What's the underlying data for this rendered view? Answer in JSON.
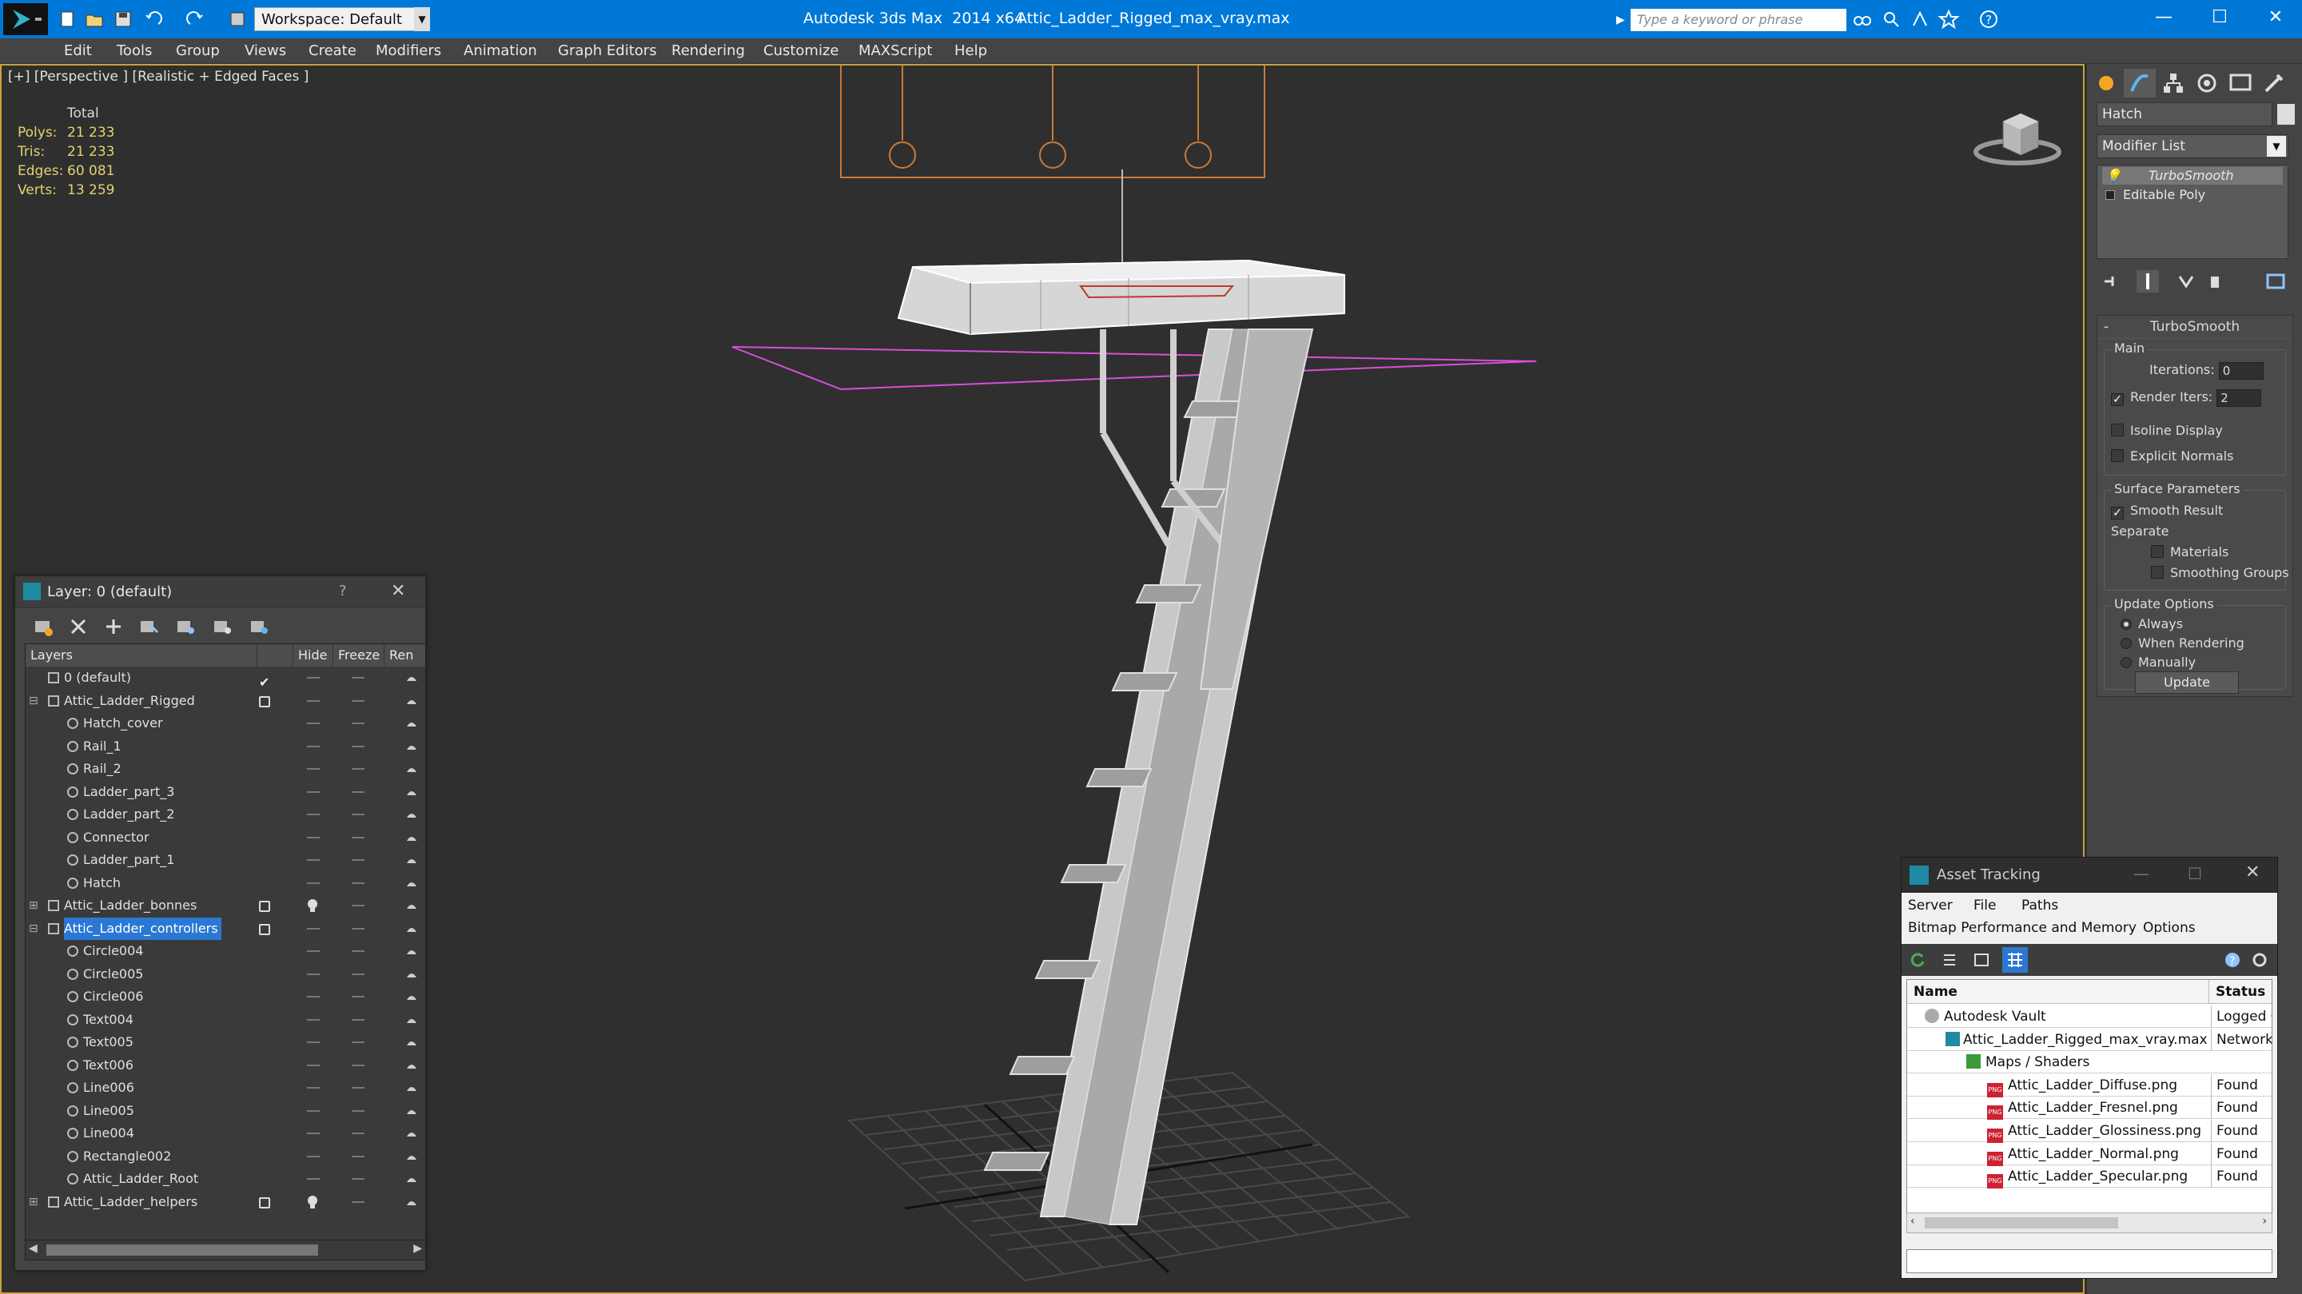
{
  "app": {
    "title": "Autodesk 3ds Max  2014 x64",
    "file": "Attic_Ladder_Rigged_max_vray.max",
    "workspace": "Workspace: Default",
    "search_placeholder": "Type a keyword or phrase",
    "accent": "#0078d7"
  },
  "menu": [
    "Edit",
    "Tools",
    "Group",
    "Views",
    "Create",
    "Modifiers",
    "Animation",
    "Graph Editors",
    "Rendering",
    "Customize",
    "MAXScript",
    "Help"
  ],
  "viewport": {
    "label": "[+] [Perspective ] [Realistic + Edged Faces ]",
    "stats": {
      "header": "Total",
      "rows": [
        {
          "k": "Polys:",
          "v": "21 233"
        },
        {
          "k": "Tris:",
          "v": "21 233"
        },
        {
          "k": "Edges:",
          "v": "60 081"
        },
        {
          "k": "Verts:",
          "v": "13 259"
        }
      ]
    }
  },
  "command_panel": {
    "object_name": "Hatch",
    "modifier_list": "Modifier List",
    "stack": [
      "TurboSmooth",
      "Editable Poly"
    ],
    "rollout_title": "TurboSmooth",
    "main_group": "Main",
    "iterations_label": "Iterations:",
    "iterations_value": "0",
    "render_iters_label": "Render Iters:",
    "render_iters_value": "2",
    "isoline": "Isoline Display",
    "explicit_normals": "Explicit Normals",
    "surface_group": "Surface Parameters",
    "smooth_result": "Smooth Result",
    "separate": "Separate",
    "materials": "Materials",
    "smoothing_groups": "Smoothing Groups",
    "update_group": "Update Options",
    "always": "Always",
    "when_rendering": "When Rendering",
    "manually": "Manually",
    "update_button": "Update"
  },
  "layer_dialog": {
    "title": "Layer: 0 (default)",
    "help": "?",
    "columns": [
      "Layers",
      "Hide",
      "Freeze",
      "Ren"
    ],
    "rows": [
      {
        "name": "0 (default)",
        "level": 0,
        "type": "layer",
        "current": true
      },
      {
        "name": "Attic_Ladder_Rigged",
        "level": 0,
        "type": "layer",
        "expand": "-"
      },
      {
        "name": "Hatch_cover",
        "level": 1,
        "type": "object"
      },
      {
        "name": "Rail_1",
        "level": 1,
        "type": "object"
      },
      {
        "name": "Rail_2",
        "level": 1,
        "type": "object"
      },
      {
        "name": "Ladder_part_3",
        "level": 1,
        "type": "object"
      },
      {
        "name": "Ladder_part_2",
        "level": 1,
        "type": "object"
      },
      {
        "name": "Connector",
        "level": 1,
        "type": "object"
      },
      {
        "name": "Ladder_part_1",
        "level": 1,
        "type": "object"
      },
      {
        "name": "Hatch",
        "level": 1,
        "type": "object"
      },
      {
        "name": "Attic_Ladder_bonnes",
        "level": 0,
        "type": "layer",
        "expand": "+",
        "hidden": true
      },
      {
        "name": "Attic_Ladder_controllers",
        "level": 0,
        "type": "layer",
        "expand": "-",
        "selected": true
      },
      {
        "name": "Circle004",
        "level": 1,
        "type": "object"
      },
      {
        "name": "Circle005",
        "level": 1,
        "type": "object"
      },
      {
        "name": "Circle006",
        "level": 1,
        "type": "object"
      },
      {
        "name": "Text004",
        "level": 1,
        "type": "object"
      },
      {
        "name": "Text005",
        "level": 1,
        "type": "object"
      },
      {
        "name": "Text006",
        "level": 1,
        "type": "object"
      },
      {
        "name": "Line006",
        "level": 1,
        "type": "object"
      },
      {
        "name": "Line005",
        "level": 1,
        "type": "object"
      },
      {
        "name": "Line004",
        "level": 1,
        "type": "object"
      },
      {
        "name": "Rectangle002",
        "level": 1,
        "type": "object"
      },
      {
        "name": "Attic_Ladder_Root",
        "level": 1,
        "type": "object"
      },
      {
        "name": "Attic_Ladder_helpers",
        "level": 0,
        "type": "layer",
        "expand": "+",
        "hidden": true
      }
    ]
  },
  "asset_dialog": {
    "title": "Asset Tracking",
    "menu1": [
      "Server",
      "File",
      "Paths"
    ],
    "menu2": [
      "Bitmap Performance and Memory",
      "Options"
    ],
    "columns": [
      "Name",
      "Status"
    ],
    "rows": [
      {
        "name": "Autodesk Vault",
        "status": "Logged C",
        "indent": 0,
        "icon": "vault"
      },
      {
        "name": "Attic_Ladder_Rigged_max_vray.max",
        "status": "Network I",
        "indent": 1,
        "icon": "max"
      },
      {
        "name": "Maps / Shaders",
        "status": "",
        "indent": 2,
        "icon": "maps"
      },
      {
        "name": "Attic_Ladder_Diffuse.png",
        "status": "Found",
        "indent": 3,
        "icon": "png"
      },
      {
        "name": "Attic_Ladder_Fresnel.png",
        "status": "Found",
        "indent": 3,
        "icon": "png"
      },
      {
        "name": "Attic_Ladder_Glossiness.png",
        "status": "Found",
        "indent": 3,
        "icon": "png"
      },
      {
        "name": "Attic_Ladder_Normal.png",
        "status": "Found",
        "indent": 3,
        "icon": "png"
      },
      {
        "name": "Attic_Ladder_Specular.png",
        "status": "Found",
        "indent": 3,
        "icon": "png"
      }
    ]
  }
}
